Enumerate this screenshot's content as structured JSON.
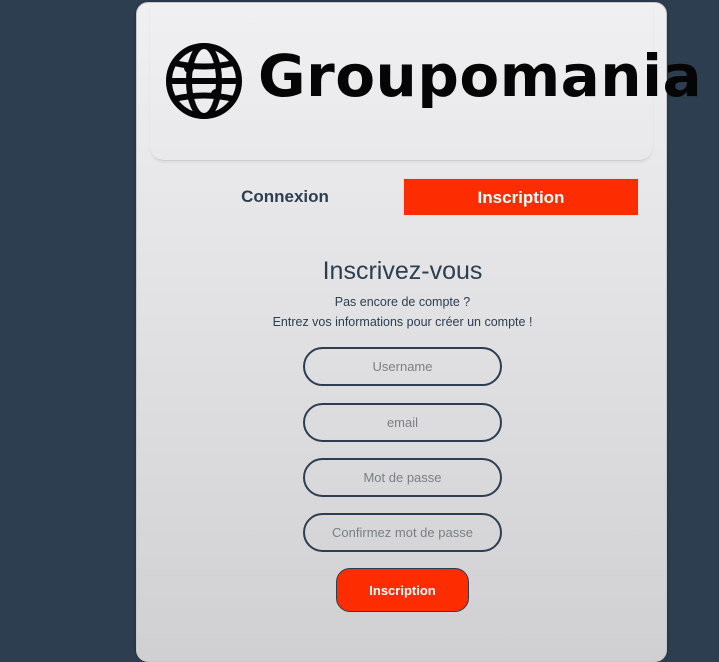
{
  "brand": {
    "name": "Groupomania",
    "icon": "globe-icon"
  },
  "tabs": {
    "login_label": "Connexion",
    "signup_label": "Inscription",
    "active": "signup"
  },
  "form": {
    "title": "Inscrivez-vous",
    "subtitle_line1": "Pas encore de compte ?",
    "subtitle_line2": "Entrez vos informations pour créer un compte !",
    "username_placeholder": "Username",
    "email_placeholder": "email",
    "password_placeholder": "Mot de passe",
    "confirm_placeholder": "Confirmez mot de passe",
    "submit_label": "Inscription"
  },
  "colors": {
    "background": "#2c3e50",
    "accent": "#fd2d01",
    "text": "#2c3e50"
  }
}
